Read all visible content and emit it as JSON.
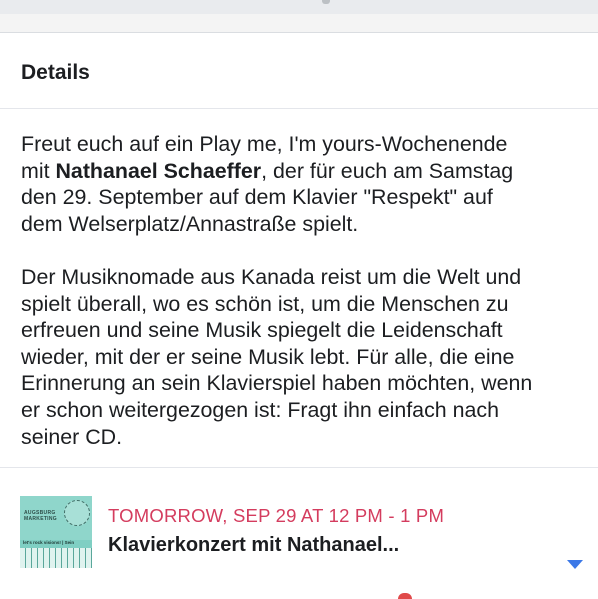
{
  "details": {
    "title": "Details",
    "description_lines": [
      "Freut euch auf ein Play me, I'm yours-Wochenende",
      [
        "mit ",
        "Nathanael Schaeffer",
        ", der für euch am Samstag"
      ],
      "den 29. September auf dem Klavier \"Respekt\" auf",
      "dem Welserplatz/Annastraße spielt.",
      "",
      "Der Musiknomade aus Kanada reist um die Welt und",
      "spielt überall, wo es schön ist, um die Menschen zu",
      "erfreuen und seine Musik spiegelt die Leidenschaft",
      "wieder, mit der er seine Musik lebt. Für alle, die eine",
      "Erinnerung an sein Klavierspiel haben möchten, wenn",
      "er schon weitergezogen ist: Fragt ihn einfach nach",
      "seiner CD."
    ]
  },
  "event": {
    "date": "TOMORROW, SEP 29 AT 12 PM - 1 PM",
    "title": "Klavierkonzert mit Nathanael...",
    "thumbnail_logo": "AUGSBURG\nMARKETING",
    "thumbnail_tag": "let's rock visions! | Sein",
    "chevron_icon": "chevron-down-icon"
  },
  "colors": {
    "date_color": "#d43c5e",
    "chevron_color": "#3b78e7",
    "thumb_color": "#7fcfc3"
  }
}
